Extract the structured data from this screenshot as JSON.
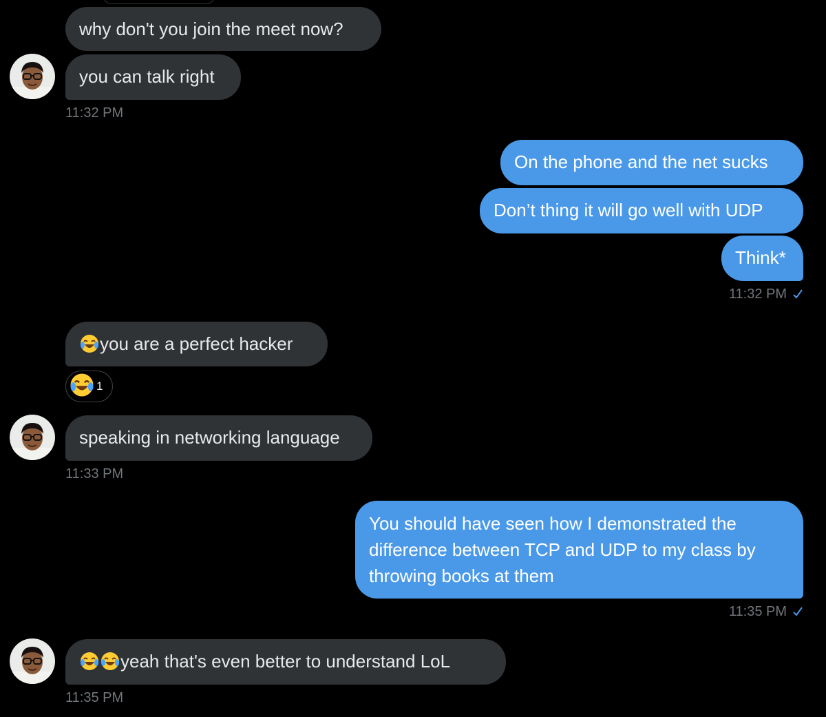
{
  "messages": [
    {
      "text": "why don't you join the meet now?"
    },
    {
      "text": "you can talk right"
    },
    {
      "text": "On the phone and the net sucks"
    },
    {
      "text": "Don’t thing it will go well with UDP"
    },
    {
      "text": "Think*"
    },
    {
      "text": "you are a perfect hacker"
    },
    {
      "text": "speaking in networking language"
    },
    {
      "text": "You should have seen how I demonstrated the difference between TCP and UDP to my class by throwing books at them"
    },
    {
      "text": "yeah that's even better to understand LoL"
    }
  ],
  "timestamps": {
    "t1": "11:32 PM",
    "t2": "11:32 PM",
    "t3": "11:33 PM",
    "t4": "11:35 PM",
    "t5": "11:35 PM"
  },
  "read_receipt_icon": "checkmark-icon",
  "reaction": {
    "emoji": "face-with-tears-of-joy-icon",
    "count": "1"
  },
  "colors": {
    "background": "#000000",
    "received_bubble": "#2f3336",
    "sent_bubble": "#4a99e9",
    "timestamp": "#71767b",
    "text": "#e7e9ea"
  }
}
